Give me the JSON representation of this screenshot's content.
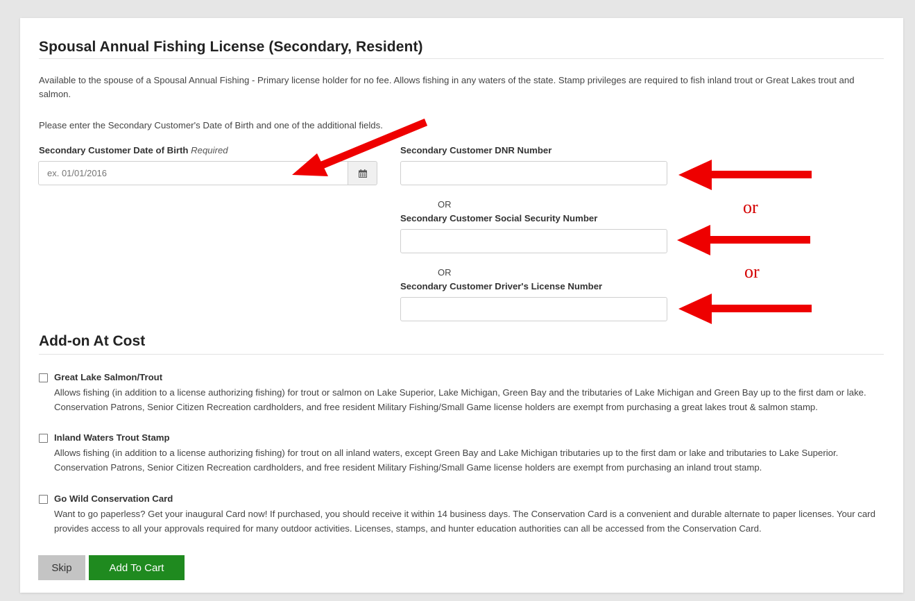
{
  "page": {
    "title": "Spousal Annual Fishing License (Secondary, Resident)",
    "description": "Available to the spouse of a Spousal Annual Fishing - Primary license holder for no fee. Allows fishing in any waters of the state. Stamp privileges are required to fish inland trout or Great Lakes trout and salmon.",
    "instruction": "Please enter the Secondary Customer's Date of Birth and one of the additional fields."
  },
  "form": {
    "dob_label": "Secondary Customer Date of Birth",
    "dob_required": "Required",
    "dob_placeholder": "ex. 01/01/2016",
    "dob_value": "",
    "calendar_icon": "calendar-icon",
    "dnr_label": "Secondary Customer DNR Number",
    "dnr_value": "",
    "or_text": "OR",
    "ssn_label": "Secondary Customer Social Security Number",
    "ssn_value": "",
    "dl_label": "Secondary Customer Driver's License Number",
    "dl_value": ""
  },
  "annotations": {
    "or_text": "or",
    "arrow_color": "#ee0000",
    "arrow_icon": "red-arrow-icon"
  },
  "addons": {
    "title": "Add-on At Cost",
    "items": [
      {
        "name": "Great Lake Salmon/Trout",
        "checked": false,
        "description": "Allows fishing (in addition to a license authorizing fishing) for trout or salmon on Lake Superior, Lake Michigan, Green Bay and the tributaries of Lake Michigan and Green Bay up to the first dam or lake. Conservation Patrons, Senior Citizen Recreation cardholders, and free resident Military Fishing/Small Game license holders are exempt from purchasing a great lakes trout & salmon stamp."
      },
      {
        "name": "Inland Waters Trout Stamp",
        "checked": false,
        "description": "Allows fishing (in addition to a license authorizing fishing) for trout on all inland waters, except Green Bay and Lake Michigan tributaries up to the first dam or lake and tributaries to Lake Superior. Conservation Patrons, Senior Citizen Recreation cardholders, and free resident Military Fishing/Small Game license holders are exempt from purchasing an inland trout stamp."
      },
      {
        "name": "Go Wild Conservation Card",
        "checked": false,
        "description": "Want to go paperless? Get your inaugural Card now! If purchased, you should receive it within 14 business days. The Conservation Card is a convenient and durable alternate to paper licenses. Your card provides access to all your approvals required for many outdoor activities. Licenses, stamps, and hunter education authorities can all be accessed from the Conservation Card."
      }
    ]
  },
  "buttons": {
    "skip": "Skip",
    "add_to_cart": "Add To Cart"
  },
  "colors": {
    "accent_green": "#1f8a1f",
    "skip_gray": "#c4c4c4",
    "annotation_red": "#d40000"
  }
}
